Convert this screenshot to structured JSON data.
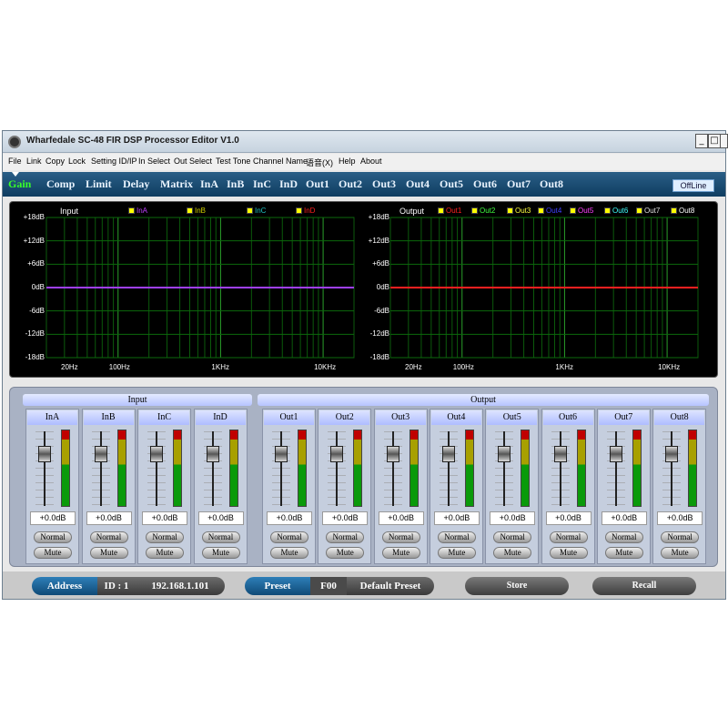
{
  "window": {
    "title": "Wharfedale SC-48 FIR DSP Processor Editor V1.0",
    "controls": [
      "_",
      "□",
      "X"
    ]
  },
  "menu": [
    "File",
    "Link",
    "Copy",
    "Lock",
    "Setting ID/IP",
    "In Select",
    "Out Select",
    "Test Tone",
    "Channel Name",
    "语音(X)",
    "Help",
    "About"
  ],
  "tabs": [
    "Gain",
    "Comp",
    "Limit",
    "Delay",
    "Matrix",
    "InA",
    "InB",
    "InC",
    "InD",
    "Out1",
    "Out2",
    "Out3",
    "Out4",
    "Out5",
    "Out6",
    "Out7",
    "Out8"
  ],
  "active_tab": "Gain",
  "connection_status": "OffLine",
  "input_graph": {
    "title": "Input",
    "legend": [
      {
        "name": "InA",
        "color": "#c040ff"
      },
      {
        "name": "InB",
        "color": "#d0d000"
      },
      {
        "name": "InC",
        "color": "#20c0c0"
      },
      {
        "name": "InD",
        "color": "#ff2020"
      }
    ],
    "line_color": "#a040ff"
  },
  "output_graph": {
    "title": "Output",
    "legend": [
      {
        "name": "Out1",
        "color": "#ff2020"
      },
      {
        "name": "Out2",
        "color": "#40ff40"
      },
      {
        "name": "Out3",
        "color": "#ffff40"
      },
      {
        "name": "Out4",
        "color": "#4040ff"
      },
      {
        "name": "Out5",
        "color": "#ff40ff"
      },
      {
        "name": "Out6",
        "color": "#40ffff"
      },
      {
        "name": "Out7",
        "color": "#e0e0e0"
      },
      {
        "name": "Out8",
        "color": "#ffffff"
      }
    ],
    "line_color": "#ff2020"
  },
  "y_labels": [
    "+18dB",
    "+12dB",
    "+6dB",
    "0dB",
    "-6dB",
    "-12dB",
    "-18dB"
  ],
  "x_labels": [
    "20Hz",
    "100Hz",
    "1KHz",
    "10KHz"
  ],
  "input_group_label": "Input",
  "output_group_label": "Output",
  "input_channels": [
    {
      "name": "InA",
      "gain": "+0.0dB",
      "normal": "Normal",
      "mute": "Mute"
    },
    {
      "name": "InB",
      "gain": "+0.0dB",
      "normal": "Normal",
      "mute": "Mute"
    },
    {
      "name": "InC",
      "gain": "+0.0dB",
      "normal": "Normal",
      "mute": "Mute"
    },
    {
      "name": "InD",
      "gain": "+0.0dB",
      "normal": "Normal",
      "mute": "Mute"
    }
  ],
  "output_channels": [
    {
      "name": "Out1",
      "gain": "+0.0dB",
      "normal": "Normal",
      "mute": "Mute"
    },
    {
      "name": "Out2",
      "gain": "+0.0dB",
      "normal": "Normal",
      "mute": "Mute"
    },
    {
      "name": "Out3",
      "gain": "+0.0dB",
      "normal": "Normal",
      "mute": "Mute"
    },
    {
      "name": "Out4",
      "gain": "+0.0dB",
      "normal": "Normal",
      "mute": "Mute"
    },
    {
      "name": "Out5",
      "gain": "+0.0dB",
      "normal": "Normal",
      "mute": "Mute"
    },
    {
      "name": "Out6",
      "gain": "+0.0dB",
      "normal": "Normal",
      "mute": "Mute"
    },
    {
      "name": "Out7",
      "gain": "+0.0dB",
      "normal": "Normal",
      "mute": "Mute"
    },
    {
      "name": "Out8",
      "gain": "+0.0dB",
      "normal": "Normal",
      "mute": "Mute"
    }
  ],
  "status": {
    "address_label": "Address",
    "id": "ID : 1",
    "ip": "192.168.1.101",
    "preset_label": "Preset",
    "preset_num": "F00",
    "preset_name": "Default Preset",
    "store": "Store",
    "recall": "Recall"
  }
}
